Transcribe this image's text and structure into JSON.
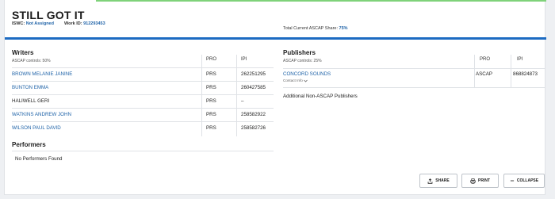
{
  "work": {
    "title": "STILL GOT IT",
    "iswc_label": "ISWC:",
    "iswc_value": "Not Assigned",
    "work_id_label": "Work ID:",
    "work_id_value": "912293453",
    "share_label": "Total Current ASCAP Share:",
    "share_value": "75%"
  },
  "writers": {
    "heading": "Writers",
    "controls": "ASCAP controls: 50%",
    "col_pro": "PRO",
    "col_ipi": "IPI",
    "rows": [
      {
        "name": "BROWN MELANIE JANINE",
        "pro": "PRS",
        "ipi": "262251295",
        "link": true
      },
      {
        "name": "BUNTON EMMA",
        "pro": "PRS",
        "ipi": "260427585",
        "link": true
      },
      {
        "name": "HALIWELL GERI",
        "pro": "PRS",
        "ipi": "–",
        "link": false
      },
      {
        "name": "WATKINS ANDREW JOHN",
        "pro": "PRS",
        "ipi": "258582922",
        "link": true
      },
      {
        "name": "WILSON PAUL DAVID",
        "pro": "PRS",
        "ipi": "258582726",
        "link": true
      }
    ]
  },
  "publishers": {
    "heading": "Publishers",
    "controls": "ASCAP controls: 25%",
    "col_pro": "PRO",
    "col_ipi": "IPI",
    "rows": [
      {
        "name": "CONCORD SOUNDS",
        "contact": "Contact Info",
        "pro": "ASCAP",
        "ipi": "868824873"
      }
    ],
    "additional": "Additional Non-ASCAP Publishers"
  },
  "performers": {
    "heading": "Performers",
    "empty": "No Performers Found"
  },
  "actions": {
    "share": "SHARE",
    "print": "PRINT",
    "collapse": "COLLAPSE"
  },
  "colors": {
    "accent_blue": "#1d6bc2",
    "link_blue": "#1f63a8",
    "top_green": "#7fd27a"
  }
}
